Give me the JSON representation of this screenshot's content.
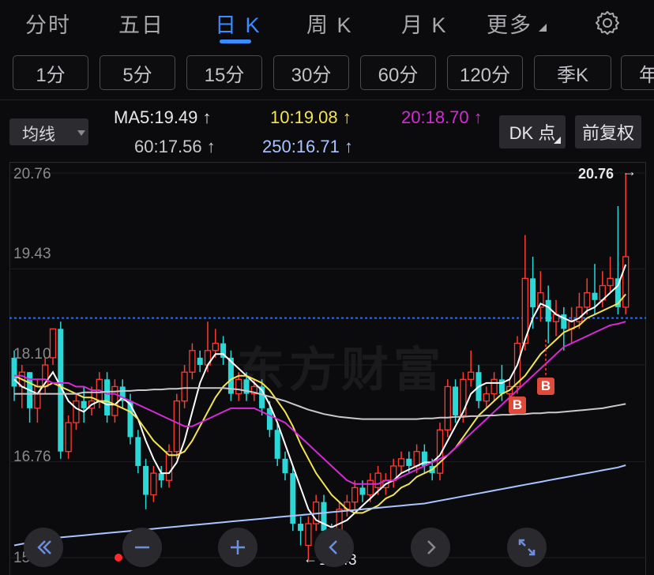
{
  "nav": {
    "tabs": [
      {
        "label": "分时"
      },
      {
        "label": "五日"
      },
      {
        "label": "日 K"
      },
      {
        "label": "周 K"
      },
      {
        "label": "月 K"
      },
      {
        "label": "更多"
      }
    ],
    "active_tab": "日 K"
  },
  "periods": [
    "1分",
    "5分",
    "15分",
    "30分",
    "60分",
    "120分",
    "季K",
    "年"
  ],
  "ma": {
    "selector_label": "均线",
    "ma5": "MA5:19.49 ↑",
    "ma10": "10:19.08 ↑",
    "ma20": "20:18.70 ↑",
    "ma60": "60:17.56 ↑",
    "ma250": "250:16.71 ↑",
    "colors": {
      "ma5": "#ffffff",
      "ma10": "#f3e451",
      "ma20": "#d62ad6",
      "ma60": "#c9c9c9",
      "ma250": "#a9c4ff"
    }
  },
  "buttons": {
    "dk": "DK 点",
    "fuquan": "前复权"
  },
  "chart": {
    "watermark": "东方财富",
    "axis_labels": [
      "20.76",
      "19.43",
      "18.10",
      "16.76",
      "15.43"
    ],
    "max_label": "20.76",
    "min_label": "15.43",
    "signal": "B",
    "colors": {
      "up": "#ff3b30",
      "down": "#2ad8d8",
      "dash": "#2f6fe0"
    }
  },
  "chart_data": {
    "type": "candlestick",
    "ylim": [
      15.43,
      20.76
    ],
    "yticks": [
      20.76,
      19.43,
      18.1,
      16.76,
      15.43
    ],
    "last_close_ref": 18.75,
    "candles": [
      [
        18.2,
        17.8,
        18.3,
        17.6
      ],
      [
        17.8,
        18.0,
        18.1,
        17.5
      ],
      [
        18.0,
        17.5,
        18.0,
        17.3
      ],
      [
        17.5,
        17.8,
        17.9,
        17.3
      ],
      [
        17.8,
        18.1,
        18.2,
        17.7
      ],
      [
        18.2,
        18.6,
        18.6,
        18.1
      ],
      [
        18.6,
        16.9,
        18.7,
        16.8
      ],
      [
        16.9,
        17.3,
        17.4,
        16.8
      ],
      [
        17.3,
        17.6,
        17.7,
        17.2
      ],
      [
        17.6,
        17.5,
        17.8,
        17.3
      ],
      [
        17.5,
        17.6,
        17.8,
        17.4
      ],
      [
        17.6,
        17.9,
        18.0,
        17.5
      ],
      [
        17.9,
        17.4,
        18.0,
        17.3
      ],
      [
        17.4,
        17.8,
        17.9,
        17.3
      ],
      [
        17.8,
        17.6,
        17.9,
        17.5
      ],
      [
        17.6,
        17.1,
        17.7,
        17.0
      ],
      [
        17.1,
        16.7,
        17.2,
        16.6
      ],
      [
        16.7,
        16.3,
        16.8,
        16.1
      ],
      [
        16.3,
        16.6,
        16.7,
        16.2
      ],
      [
        16.6,
        16.5,
        16.7,
        16.4
      ],
      [
        16.5,
        16.9,
        17.0,
        16.4
      ],
      [
        16.9,
        17.6,
        17.7,
        16.8
      ],
      [
        17.6,
        18.0,
        18.1,
        17.5
      ],
      [
        18.0,
        18.3,
        18.4,
        17.9
      ],
      [
        18.2,
        18.1,
        18.3,
        18.0
      ],
      [
        18.1,
        18.3,
        18.7,
        18.0
      ],
      [
        18.3,
        18.4,
        18.6,
        18.2
      ],
      [
        18.4,
        18.2,
        18.5,
        18.1
      ],
      [
        18.2,
        17.7,
        18.3,
        17.6
      ],
      [
        17.7,
        17.9,
        18.0,
        17.6
      ],
      [
        17.9,
        17.7,
        18.0,
        17.6
      ],
      [
        17.7,
        17.8,
        17.9,
        17.6
      ],
      [
        17.8,
        17.5,
        17.9,
        17.4
      ],
      [
        17.5,
        17.2,
        17.6,
        17.1
      ],
      [
        17.2,
        16.8,
        17.3,
        16.7
      ],
      [
        16.8,
        16.6,
        16.9,
        16.5
      ],
      [
        16.6,
        15.9,
        16.7,
        15.8
      ],
      [
        15.9,
        15.8,
        16.0,
        15.6
      ],
      [
        15.6,
        15.9,
        16.0,
        15.4
      ],
      [
        15.9,
        16.2,
        16.3,
        15.8
      ],
      [
        16.2,
        15.8,
        16.3,
        15.7
      ],
      [
        15.8,
        15.6,
        15.9,
        15.5
      ],
      [
        15.6,
        16.1,
        16.2,
        15.5
      ],
      [
        16.1,
        16.2,
        16.3,
        16.0
      ],
      [
        16.2,
        16.4,
        16.5,
        16.1
      ],
      [
        16.4,
        16.3,
        16.5,
        16.2
      ],
      [
        16.3,
        16.5,
        16.6,
        16.2
      ],
      [
        16.4,
        16.6,
        16.7,
        16.3
      ],
      [
        16.4,
        16.5,
        16.6,
        16.3
      ],
      [
        16.5,
        16.7,
        16.8,
        16.4
      ],
      [
        16.7,
        16.8,
        16.9,
        16.6
      ],
      [
        16.8,
        16.7,
        16.9,
        16.6
      ],
      [
        16.7,
        16.9,
        17.0,
        16.6
      ],
      [
        16.9,
        16.7,
        17.0,
        16.6
      ],
      [
        16.7,
        16.6,
        16.8,
        16.5
      ],
      [
        16.6,
        17.2,
        17.3,
        16.5
      ],
      [
        17.2,
        17.8,
        17.9,
        17.1
      ],
      [
        17.8,
        17.4,
        17.9,
        17.3
      ],
      [
        17.4,
        17.9,
        18.0,
        17.3
      ],
      [
        17.9,
        18.0,
        18.3,
        17.8
      ],
      [
        18.0,
        17.6,
        18.1,
        17.5
      ],
      [
        17.6,
        17.7,
        17.8,
        17.5
      ],
      [
        17.7,
        17.9,
        18.0,
        17.6
      ],
      [
        17.9,
        17.7,
        18.1,
        17.6
      ],
      [
        17.7,
        17.8,
        17.9,
        17.6
      ],
      [
        17.8,
        18.4,
        18.5,
        17.7
      ],
      [
        18.4,
        19.3,
        19.9,
        18.3
      ],
      [
        19.3,
        18.9,
        19.6,
        18.6
      ],
      [
        18.9,
        19.1,
        19.4,
        18.7
      ],
      [
        19.0,
        18.7,
        19.2,
        18.4
      ],
      [
        18.7,
        18.8,
        19.0,
        18.5
      ],
      [
        18.8,
        18.6,
        18.9,
        18.3
      ],
      [
        18.6,
        18.7,
        18.9,
        18.4
      ],
      [
        18.7,
        18.9,
        19.1,
        18.6
      ],
      [
        18.9,
        19.1,
        19.3,
        18.8
      ],
      [
        19.1,
        19.0,
        19.5,
        18.8
      ],
      [
        19.0,
        19.2,
        19.4,
        18.9
      ],
      [
        19.2,
        19.3,
        19.6,
        19.1
      ],
      [
        19.3,
        18.9,
        20.3,
        18.8
      ],
      [
        18.9,
        19.6,
        20.76,
        18.8
      ]
    ],
    "series": [
      {
        "name": "MA5",
        "values": [
          17.9,
          17.8,
          17.75,
          17.7,
          17.85,
          18.0,
          17.8,
          17.6,
          17.5,
          17.45,
          17.55,
          17.6,
          17.55,
          17.55,
          17.65,
          17.55,
          17.35,
          17.05,
          16.8,
          16.6,
          16.6,
          16.75,
          17.05,
          17.45,
          17.85,
          18.1,
          18.25,
          18.25,
          18.15,
          18.05,
          17.95,
          17.85,
          17.75,
          17.55,
          17.3,
          17.0,
          16.7,
          16.4,
          16.1,
          15.95,
          15.9,
          15.85,
          15.9,
          15.95,
          16.05,
          16.15,
          16.25,
          16.35,
          16.45,
          16.5,
          16.6,
          16.65,
          16.7,
          16.75,
          16.75,
          16.85,
          17.05,
          17.25,
          17.45,
          17.7,
          17.8,
          17.85,
          17.85,
          17.85,
          17.9,
          18.1,
          18.45,
          18.75,
          18.95,
          18.9,
          18.8,
          18.75,
          18.7,
          18.75,
          18.85,
          18.9,
          19.0,
          19.1,
          19.2,
          19.49
        ]
      },
      {
        "name": "10",
        "values": [
          17.95,
          17.9,
          17.85,
          17.8,
          17.8,
          17.85,
          17.8,
          17.75,
          17.7,
          17.65,
          17.65,
          17.6,
          17.6,
          17.55,
          17.5,
          17.45,
          17.35,
          17.2,
          17.05,
          16.95,
          16.85,
          16.85,
          16.9,
          17.05,
          17.25,
          17.45,
          17.65,
          17.8,
          17.9,
          17.95,
          17.95,
          17.9,
          17.85,
          17.75,
          17.6,
          17.45,
          17.25,
          17.0,
          16.8,
          16.6,
          16.45,
          16.3,
          16.2,
          16.1,
          16.05,
          16.05,
          16.1,
          16.15,
          16.25,
          16.3,
          16.4,
          16.45,
          16.55,
          16.6,
          16.65,
          16.75,
          16.85,
          16.95,
          17.1,
          17.25,
          17.4,
          17.5,
          17.6,
          17.7,
          17.75,
          17.85,
          17.95,
          18.1,
          18.25,
          18.35,
          18.45,
          18.55,
          18.6,
          18.65,
          18.75,
          18.8,
          18.85,
          18.9,
          18.95,
          19.08
        ]
      },
      {
        "name": "20",
        "values": [
          17.95,
          17.95,
          17.9,
          17.9,
          17.9,
          17.85,
          17.85,
          17.85,
          17.8,
          17.8,
          17.75,
          17.75,
          17.7,
          17.7,
          17.65,
          17.6,
          17.55,
          17.5,
          17.45,
          17.4,
          17.35,
          17.3,
          17.25,
          17.25,
          17.3,
          17.35,
          17.4,
          17.45,
          17.5,
          17.5,
          17.5,
          17.5,
          17.45,
          17.4,
          17.35,
          17.3,
          17.2,
          17.1,
          17.0,
          16.9,
          16.8,
          16.7,
          16.6,
          16.5,
          16.45,
          16.45,
          16.45,
          16.45,
          16.5,
          16.5,
          16.55,
          16.6,
          16.65,
          16.7,
          16.75,
          16.8,
          16.85,
          16.95,
          17.05,
          17.15,
          17.25,
          17.35,
          17.45,
          17.55,
          17.65,
          17.75,
          17.85,
          17.95,
          18.05,
          18.15,
          18.25,
          18.35,
          18.4,
          18.45,
          18.5,
          18.55,
          18.6,
          18.65,
          18.67,
          18.7
        ]
      },
      {
        "name": "60",
        "values": [
          17.7,
          17.7,
          17.7,
          17.7,
          17.7,
          17.7,
          17.7,
          17.7,
          17.7,
          17.72,
          17.72,
          17.72,
          17.73,
          17.73,
          17.74,
          17.74,
          17.75,
          17.75,
          17.76,
          17.76,
          17.77,
          17.77,
          17.78,
          17.78,
          17.78,
          17.78,
          17.78,
          17.78,
          17.77,
          17.76,
          17.74,
          17.72,
          17.69,
          17.66,
          17.63,
          17.6,
          17.56,
          17.52,
          17.48,
          17.45,
          17.42,
          17.4,
          17.38,
          17.37,
          17.36,
          17.35,
          17.35,
          17.35,
          17.35,
          17.35,
          17.35,
          17.35,
          17.35,
          17.36,
          17.36,
          17.37,
          17.37,
          17.38,
          17.38,
          17.39,
          17.39,
          17.4,
          17.4,
          17.41,
          17.41,
          17.42,
          17.42,
          17.43,
          17.43,
          17.44,
          17.44,
          17.45,
          17.46,
          17.47,
          17.48,
          17.49,
          17.5,
          17.52,
          17.54,
          17.56
        ]
      },
      {
        "name": "250",
        "values": [
          15.6,
          15.62,
          15.64,
          15.66,
          15.68,
          15.7,
          15.71,
          15.72,
          15.73,
          15.74,
          15.75,
          15.76,
          15.77,
          15.78,
          15.79,
          15.8,
          15.81,
          15.82,
          15.83,
          15.84,
          15.85,
          15.86,
          15.87,
          15.88,
          15.89,
          15.9,
          15.91,
          15.92,
          15.93,
          15.94,
          15.95,
          15.96,
          15.97,
          15.98,
          15.99,
          16.0,
          16.01,
          16.02,
          16.03,
          16.04,
          16.05,
          16.06,
          16.07,
          16.08,
          16.09,
          16.1,
          16.11,
          16.12,
          16.13,
          16.14,
          16.15,
          16.16,
          16.17,
          16.18,
          16.2,
          16.22,
          16.24,
          16.26,
          16.28,
          16.3,
          16.32,
          16.34,
          16.36,
          16.38,
          16.4,
          16.42,
          16.44,
          16.46,
          16.48,
          16.5,
          16.52,
          16.54,
          16.56,
          16.58,
          16.6,
          16.62,
          16.64,
          16.66,
          16.68,
          16.71
        ]
      }
    ],
    "buy_signals": [
      64,
      72
    ]
  }
}
